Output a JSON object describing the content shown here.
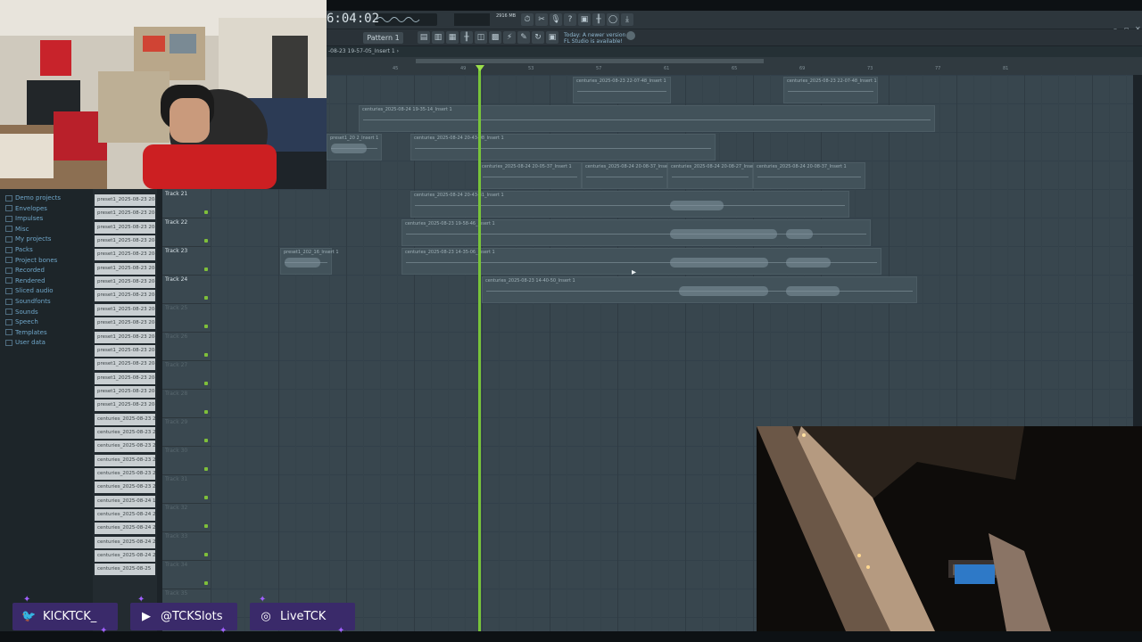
{
  "fl": {
    "time": "6:04:02",
    "pattern_label": "Pattern 1",
    "cpu_label": "2916 MB",
    "news_line1": "Today: A newer version of",
    "news_line2": "FL Studio is available!",
    "playlist_title": "-08-23 19-57-05_Insert 1 ›"
  },
  "timeline": {
    "ticks": [
      "45",
      "",
      "49",
      "",
      "53",
      "",
      "57",
      "",
      "61",
      "",
      "65",
      "",
      "69",
      "",
      "73",
      "",
      "77",
      "",
      "81"
    ]
  },
  "tracks": [
    {
      "name": "Track 21",
      "active": true
    },
    {
      "name": "Track 22",
      "active": true
    },
    {
      "name": "Track 23",
      "active": true
    },
    {
      "name": "Track 24",
      "active": true
    },
    {
      "name": "Track 25",
      "active": false
    },
    {
      "name": "Track 26",
      "active": false
    },
    {
      "name": "Track 27",
      "active": false
    },
    {
      "name": "Track 28",
      "active": false
    },
    {
      "name": "Track 29",
      "active": false
    },
    {
      "name": "Track 30",
      "active": false
    },
    {
      "name": "Track 31",
      "active": false
    },
    {
      "name": "Track 32",
      "active": false
    },
    {
      "name": "Track 33",
      "active": false
    },
    {
      "name": "Track 34",
      "active": false
    },
    {
      "name": "Track 35",
      "active": false
    }
  ],
  "browser": {
    "items": [
      "Demo projects",
      "Envelopes",
      "Impulses",
      "Misc",
      "My projects",
      "Packs",
      "Project bones",
      "Recorded",
      "Rendered",
      "Sliced audio",
      "Soundfonts",
      "Sounds",
      "Speech",
      "Templates",
      "User data"
    ]
  },
  "picker": {
    "items": [
      "preset1_2025-08-23 20-",
      "preset1_2025-08-23 20-",
      "preset1_2025-08-23 20-",
      "preset1_2025-08-23 20-",
      "preset1_2025-08-23 20-",
      "preset1_2025-08-23 20-",
      "preset1_2025-08-23 20-",
      "preset1_2025-08-23 20-",
      "preset1_2025-08-23 20-",
      "preset1_2025-08-23 20-",
      "preset1_2025-08-23 20-",
      "preset1_2025-08-23 20-",
      "preset1_2025-08-23 20-",
      "preset1_2025-08-23 20-",
      "preset1_2025-08-23 20-",
      "preset1_2025-08-23 20-",
      "centuries_2025-08-23 2.",
      "centuries_2025-08-23 2.",
      "centuries_2025-08-23 2.",
      "centuries_2025-08-23 2.",
      "centuries_2025-08-23 2.",
      "centuries_2025-08-23 2.",
      "centuries_2025-08-24 1.",
      "centuries_2025-08-24 2.",
      "centuries_2025-08-24 2.",
      "centuries_2025-08-24 2.",
      "centuries_2025-08-24 2.",
      "centuries_2025-08-25"
    ]
  },
  "clips": [
    {
      "label": "centuries_2025-08-23 22-07-48_Insert 1"
    },
    {
      "label": "centuries_2025-08-23 22-07-48_Insert 1"
    },
    {
      "label": "centuries_2025-08-24 19-35-14_Insert 1"
    },
    {
      "label": "preset1_20 2_Insert 1"
    },
    {
      "label": "centuries_2025-08-24 20-43-08_Insert 1"
    },
    {
      "label": "centuries_2025-08-24 20-05-37_Insert 1"
    },
    {
      "label": "centuries_2025-08-24 20-08-37_Insert 1"
    },
    {
      "label": "centuries_2025-08-24 20-08-27_Insert 1"
    },
    {
      "label": "centuries_2025-08-24 20-08-37_Insert 1"
    },
    {
      "label": "centuries_2025-08-24 20-43-31_Insert 1"
    },
    {
      "label": "centuries_2025-08-23 19-58-46_Insert 1"
    },
    {
      "label": "preset1_202_16_Insert 1"
    },
    {
      "label": "centuries_2025-08-23 14-35-06_Insert 1"
    },
    {
      "label": "centuries_2025-08-23 14-40-50_Insert 1"
    }
  ],
  "socials": [
    {
      "icon": "twitter-icon",
      "glyph": "🐦",
      "label": "KICKTCK_"
    },
    {
      "icon": "youtube-icon",
      "glyph": "▶",
      "label": "@TCKSlots"
    },
    {
      "icon": "instagram-icon",
      "glyph": "◎",
      "label": "LiveTCK"
    }
  ]
}
